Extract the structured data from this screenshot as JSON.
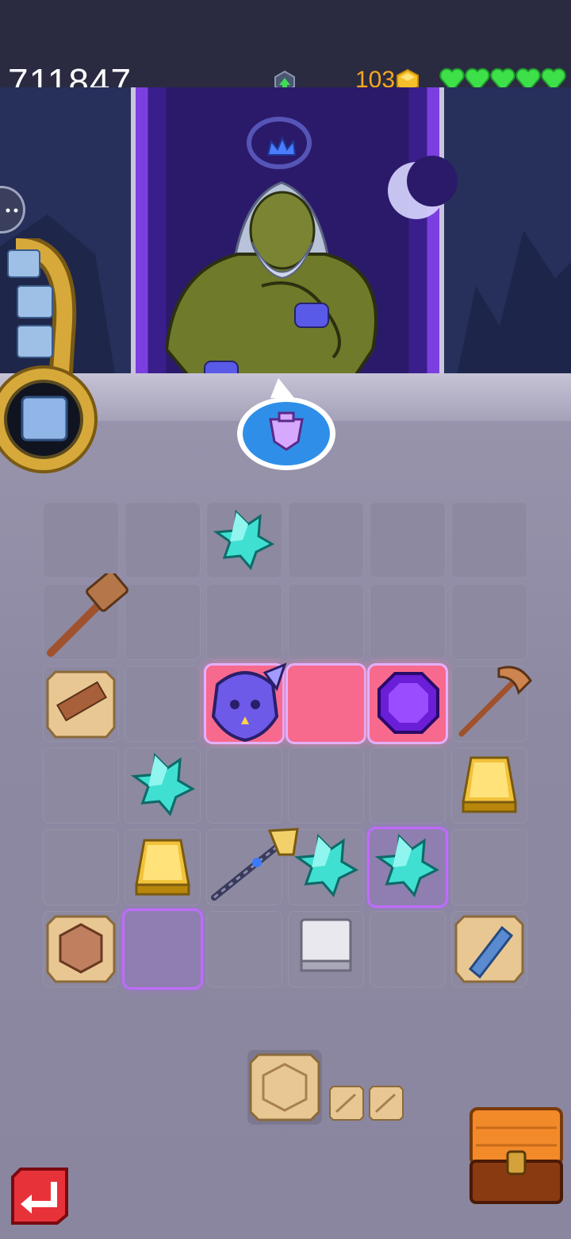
{
  "hud": {
    "score": "711847",
    "gold": "103",
    "lives": 5
  },
  "board": {
    "rows": 6,
    "cols": 6,
    "cells": [
      {
        "row": 0,
        "col": 2,
        "item": "teal-crystal-cluster"
      },
      {
        "row": 1,
        "col": 0,
        "item": "copper-hammer"
      },
      {
        "row": 2,
        "col": 0,
        "item": "wood-plank-tile"
      },
      {
        "row": 2,
        "col": 2,
        "item": "dragon-helmet",
        "highlight": "pink"
      },
      {
        "row": 2,
        "col": 3,
        "item": "empty",
        "highlight": "pink"
      },
      {
        "row": 2,
        "col": 4,
        "item": "purple-gem",
        "highlight": "pink"
      },
      {
        "row": 2,
        "col": 5,
        "item": "pickaxe"
      },
      {
        "row": 3,
        "col": 1,
        "item": "teal-crystal-cluster"
      },
      {
        "row": 3,
        "col": 5,
        "item": "gold-ingot"
      },
      {
        "row": 4,
        "col": 1,
        "item": "gold-ingot"
      },
      {
        "row": 4,
        "col": 2,
        "item": "golden-scepter"
      },
      {
        "row": 4,
        "col": 3,
        "item": "teal-crystal-cluster"
      },
      {
        "row": 4,
        "col": 4,
        "item": "teal-crystal-cluster",
        "highlight": "purple"
      },
      {
        "row": 5,
        "col": 0,
        "item": "copper-hex-tile"
      },
      {
        "row": 5,
        "col": 1,
        "item": "empty",
        "highlight": "purple"
      },
      {
        "row": 5,
        "col": 3,
        "item": "silver-ingot"
      },
      {
        "row": 5,
        "col": 5,
        "item": "blue-crystal-tile"
      }
    ]
  },
  "request_bubble": {
    "icon": "armor-request-icon"
  },
  "queue": {
    "items": [
      "sand-hex-tile",
      "sand-small-tile",
      "sand-small-tile"
    ]
  },
  "icons": {
    "undo": "undo-icon",
    "chest": "treasure-chest-icon",
    "menu": "menu-face-icon",
    "levelup": "level-up-icon",
    "gold": "gold-coin-icon",
    "heart": "heart-icon"
  },
  "colors": {
    "accent": "#7b3fe0",
    "gold_text": "#f5a623",
    "heart": "#3ee04a",
    "highlight_pink": "#f76a8e",
    "highlight_purple": "#c06bff",
    "teal": "#3fe0d2"
  }
}
